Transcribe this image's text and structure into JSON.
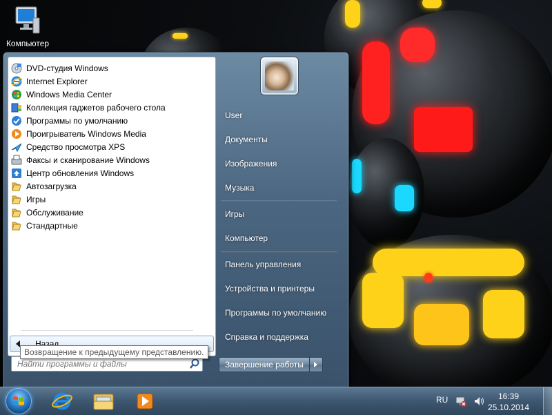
{
  "desktop": {
    "icons": [
      {
        "label": "Компьютер",
        "icon": "computer-icon"
      }
    ]
  },
  "start_menu": {
    "programs": [
      {
        "label": "DVD-студия Windows",
        "icon": "dvd-maker-icon"
      },
      {
        "label": "Internet Explorer",
        "icon": "internet-explorer-icon"
      },
      {
        "label": "Windows Media Center",
        "icon": "media-center-icon"
      },
      {
        "label": "Коллекция гаджетов рабочего стола",
        "icon": "gadgets-icon"
      },
      {
        "label": "Программы по умолчанию",
        "icon": "default-programs-icon"
      },
      {
        "label": "Проигрыватель Windows Media",
        "icon": "media-player-icon"
      },
      {
        "label": "Средство просмотра XPS",
        "icon": "xps-viewer-icon"
      },
      {
        "label": "Факсы и сканирование Windows",
        "icon": "fax-scan-icon"
      },
      {
        "label": "Центр обновления Windows",
        "icon": "windows-update-icon"
      },
      {
        "label": "Автозагрузка",
        "icon": "folder-icon"
      },
      {
        "label": "Игры",
        "icon": "folder-icon"
      },
      {
        "label": "Обслуживание",
        "icon": "folder-icon"
      },
      {
        "label": "Стандартные",
        "icon": "folder-icon"
      }
    ],
    "back_label": "Назад",
    "back_tooltip": "Возвращение к предыдущему представлению.",
    "search_placeholder": "Найти программы и файлы",
    "right_links": {
      "user": "User",
      "documents": "Документы",
      "pictures": "Изображения",
      "music": "Музыка",
      "games": "Игры",
      "computer": "Компьютер",
      "control_panel": "Панель управления",
      "devices": "Устройства и принтеры",
      "default_programs": "Программы по умолчанию",
      "help": "Справка и поддержка"
    },
    "shutdown_label": "Завершение работы"
  },
  "taskbar": {
    "pinned": [
      {
        "icon": "internet-explorer-icon"
      },
      {
        "icon": "explorer-folder-icon"
      },
      {
        "icon": "media-player-icon"
      }
    ],
    "tray": {
      "language": "RU",
      "time": "16:39",
      "date": "25.10.2014",
      "icons": [
        "network-icon",
        "volume-icon"
      ]
    }
  },
  "colors": {
    "accent": "#3d5770",
    "menu_background": "#4b6680",
    "glow_red": "#ff2a2a",
    "glow_yellow": "#ffd21a",
    "glow_cyan": "#1ad8ff"
  }
}
